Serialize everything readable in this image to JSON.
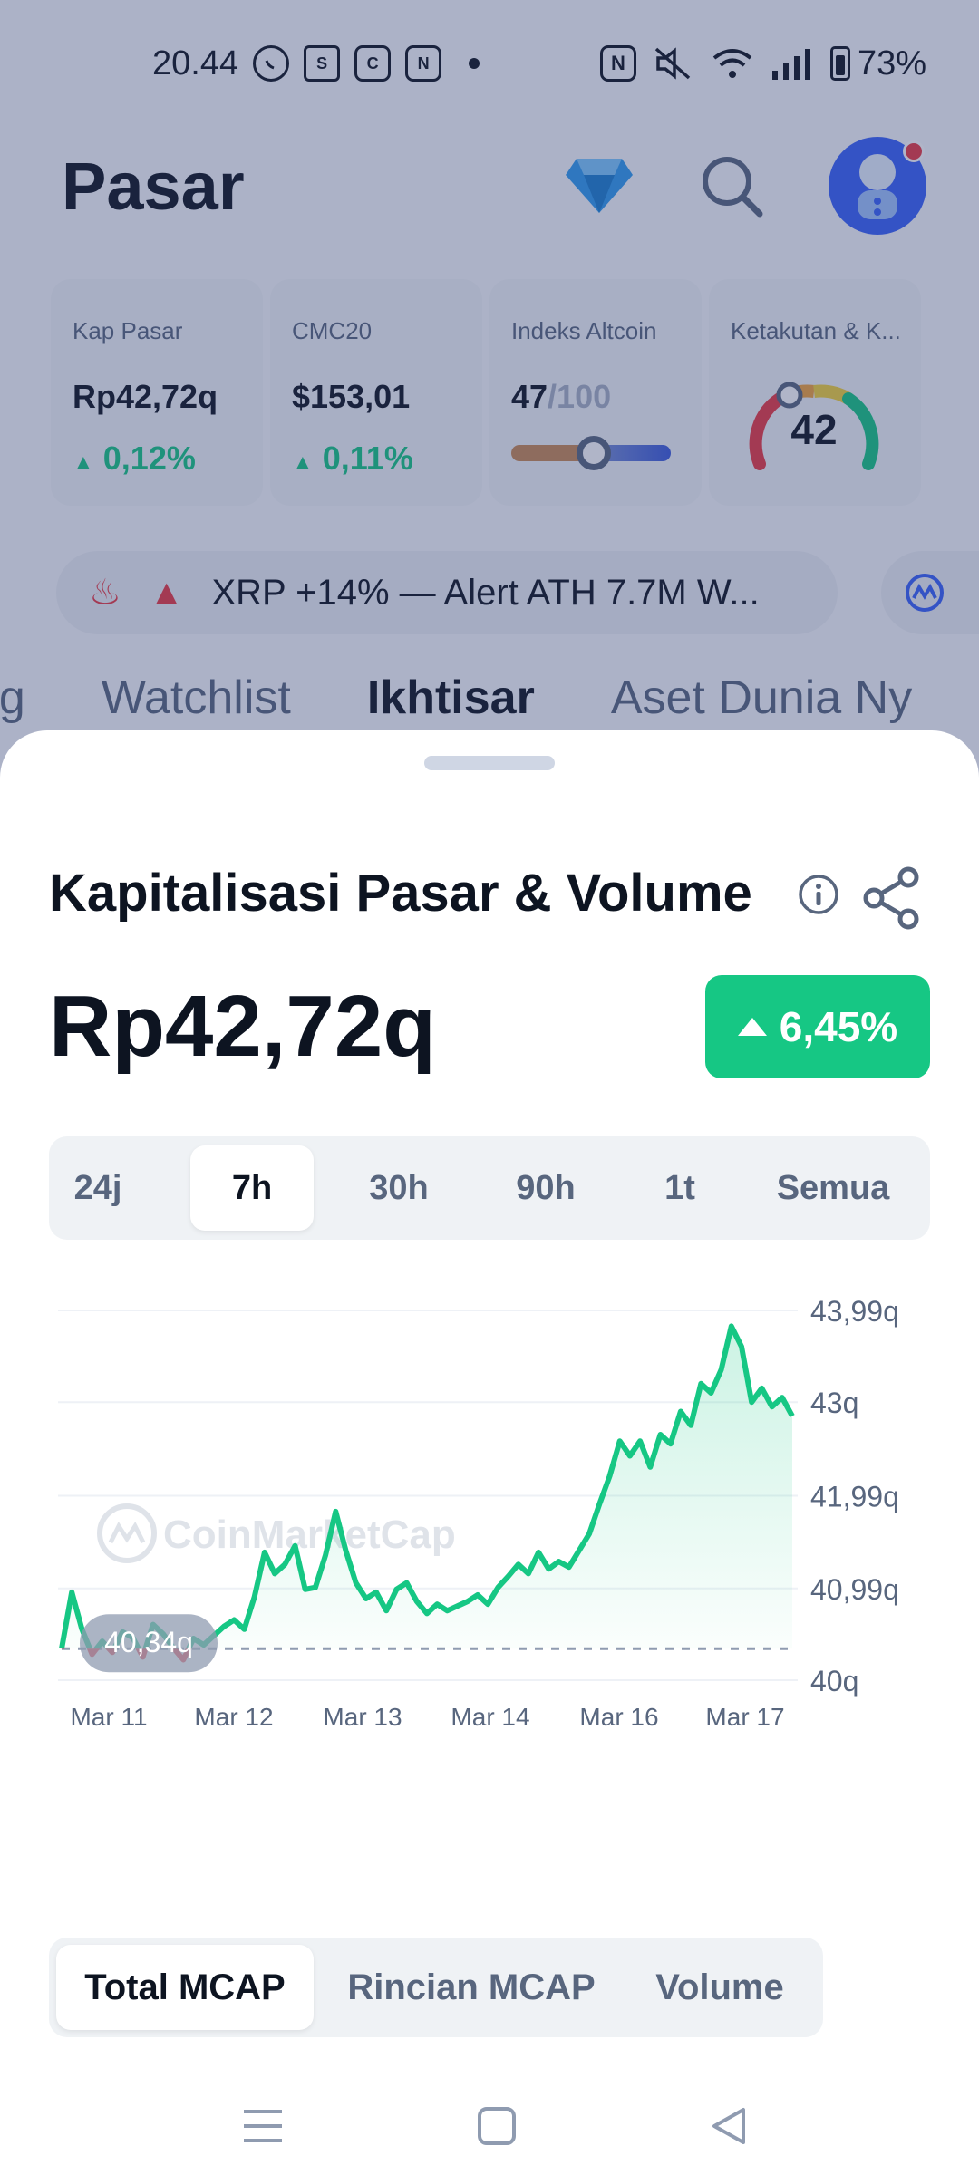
{
  "status_bar": {
    "time": "20.44",
    "battery": "73%"
  },
  "header": {
    "title": "Pasar"
  },
  "stats": {
    "market_cap": {
      "label": "Kap Pasar",
      "value": "Rp42,72q",
      "change": "0,12%"
    },
    "cmc20": {
      "label": "CMC20",
      "value": "$153,01",
      "change": "0,11%"
    },
    "altcoin_index": {
      "label": "Indeks Altcoin",
      "value": "47",
      "max": "/100",
      "level": 0.47
    },
    "fear_greed": {
      "label": "Ketakutan & K...",
      "value": "42"
    }
  },
  "ticker": {
    "text": "XRP +14% — Alert ATH 7.7M W..."
  },
  "tabs": [
    "ng",
    "Watchlist",
    "Ikhtisar",
    "Aset Dunia Ny"
  ],
  "sheet": {
    "title": "Kapitalisasi Pasar & Volume",
    "value": "Rp42,72q",
    "change": "6,45%",
    "ranges": [
      "24j",
      "7h",
      "30h",
      "90h",
      "1t",
      "Semua"
    ],
    "chart_types": [
      "Total MCAP",
      "Rincian MCAP",
      "Volume"
    ]
  },
  "colors": {
    "up": "#16c784",
    "down": "#ea3943",
    "accent": "#3861fb"
  },
  "chart_data": {
    "type": "line",
    "x_labels": [
      "Mar 11",
      "Mar 12",
      "Mar 13",
      "Mar 14",
      "Mar 16",
      "Mar 17"
    ],
    "y_tick_labels": [
      "43,99q",
      "43q",
      "41,99q",
      "40,99q",
      "40q"
    ],
    "y_ticks": [
      43.99,
      43.0,
      41.99,
      40.99,
      40.0
    ],
    "ylim": [
      40.0,
      43.99
    ],
    "reference_value": 40.34,
    "reference_label": "40,34q",
    "watermark": "CoinMarketCap",
    "values": [
      40.34,
      40.95,
      40.55,
      40.28,
      40.42,
      40.3,
      40.52,
      40.46,
      40.25,
      40.6,
      40.5,
      40.35,
      40.22,
      40.45,
      40.38,
      40.48,
      40.58,
      40.65,
      40.55,
      40.9,
      41.38,
      41.15,
      41.25,
      41.45,
      40.98,
      41.0,
      41.35,
      41.82,
      41.4,
      41.05,
      40.88,
      40.95,
      40.75,
      40.98,
      41.05,
      40.85,
      40.72,
      40.82,
      40.75,
      40.8,
      40.85,
      40.92,
      40.82,
      41.0,
      41.12,
      41.25,
      41.15,
      41.38,
      41.2,
      41.28,
      41.22,
      41.4,
      41.58,
      41.9,
      42.2,
      42.58,
      42.42,
      42.58,
      42.3,
      42.65,
      42.55,
      42.9,
      42.75,
      43.2,
      43.1,
      43.35,
      43.82,
      43.6,
      43.0,
      43.15,
      42.95,
      43.05,
      42.85
    ]
  }
}
